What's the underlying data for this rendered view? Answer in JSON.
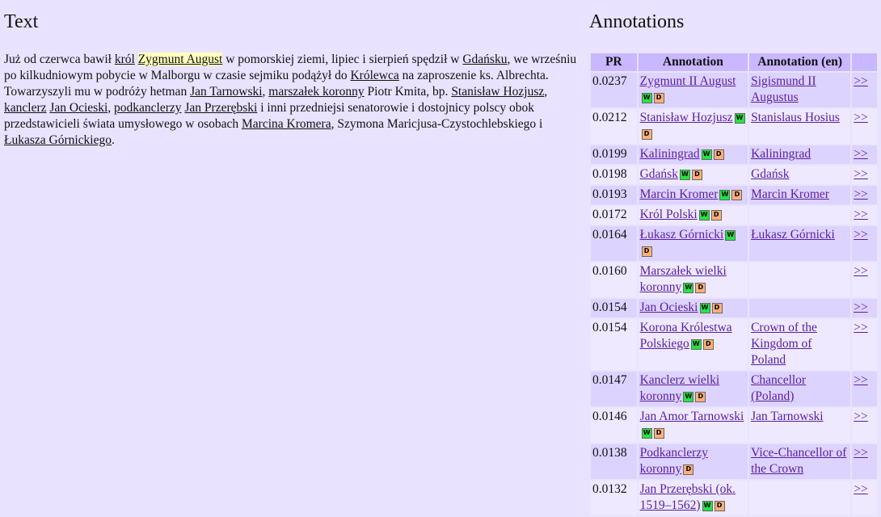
{
  "left": {
    "title": "Text",
    "paragraph": [
      {
        "t": "Już od czerwca bawił "
      },
      {
        "t": "król",
        "link": true
      },
      {
        "t": " "
      },
      {
        "t": "Zygmunt August",
        "link": true,
        "highlight": true
      },
      {
        "t": " w pomorskiej ziemi, lipiec i sierpień spędził w "
      },
      {
        "t": "Gdańsku",
        "link": true
      },
      {
        "t": ", we wrześniu po kilkudniowym pobycie w Malborgu w czasie sejmiku podążył do "
      },
      {
        "t": "Królewca",
        "link": true
      },
      {
        "t": " na zaproszenie ks. Albrechta. Towarzyszyli mu w podróży hetman "
      },
      {
        "t": "Jan Tarnowski",
        "link": true
      },
      {
        "t": ", "
      },
      {
        "t": "marszałek koronny",
        "link": true
      },
      {
        "t": " Piotr Kmita, bp. "
      },
      {
        "t": "Stanisław Hozjusz",
        "link": true
      },
      {
        "t": ", "
      },
      {
        "t": "kanclerz",
        "link": true
      },
      {
        "t": " "
      },
      {
        "t": "Jan Ocieski",
        "link": true
      },
      {
        "t": ", "
      },
      {
        "t": "podkanclerzy",
        "link": true
      },
      {
        "t": " "
      },
      {
        "t": "Jan Przerębski",
        "link": true
      },
      {
        "t": " i inni przedniejsi senatorowie i dostojnicy polscy obok przedstawicieli świata umysłowego w osobach "
      },
      {
        "t": "Marcina Kromera",
        "link": true
      },
      {
        "t": ", Szymona Maricjusa-Czystochlebskiego i "
      },
      {
        "t": "Łukasza Górnickiego",
        "link": true
      },
      {
        "t": "."
      }
    ]
  },
  "right": {
    "title": "Annotations",
    "headers": [
      "PR",
      "Annotation",
      "Annotation (en)",
      ""
    ],
    "badge_w": "W",
    "badge_d": "D",
    "more": ">>",
    "rows": [
      {
        "pr": "0.0237",
        "annotation": "Zygmunt II August",
        "en": "Sigismund II Augustus",
        "w": true,
        "d": true
      },
      {
        "pr": "0.0212",
        "annotation": "Stanisław Hozjusz",
        "en": "Stanislaus Hosius",
        "w": true,
        "d": true
      },
      {
        "pr": "0.0199",
        "annotation": "Kaliningrad",
        "en": "Kaliningrad",
        "w": true,
        "d": true
      },
      {
        "pr": "0.0198",
        "annotation": "Gdańsk",
        "en": "Gdańsk",
        "w": true,
        "d": true
      },
      {
        "pr": "0.0193",
        "annotation": "Marcin Kromer",
        "en": "Marcin Kromer",
        "w": true,
        "d": true
      },
      {
        "pr": "0.0172",
        "annotation": "Król Polski",
        "en": "",
        "w": true,
        "d": true
      },
      {
        "pr": "0.0164",
        "annotation": "Łukasz Górnicki",
        "en": "Łukasz Górnicki",
        "w": true,
        "d": true
      },
      {
        "pr": "0.0160",
        "annotation": "Marszałek wielki koronny",
        "en": "",
        "w": true,
        "d": true
      },
      {
        "pr": "0.0154",
        "annotation": "Jan Ocieski",
        "en": "",
        "w": true,
        "d": true
      },
      {
        "pr": "0.0154",
        "annotation": "Korona Królestwa Polskiego",
        "en": "Crown of the Kingdom of Poland",
        "w": true,
        "d": true
      },
      {
        "pr": "0.0147",
        "annotation": "Kanclerz wielki koronny",
        "en": "Chancellor (Poland)",
        "w": true,
        "d": true
      },
      {
        "pr": "0.0146",
        "annotation": "Jan Amor Tarnowski",
        "en": "Jan Tarnowski",
        "w": true,
        "d": true
      },
      {
        "pr": "0.0138",
        "annotation": "Podkanclerzy koronny",
        "en": "Vice-Chancellor of the Crown",
        "w": false,
        "d": true
      },
      {
        "pr": "0.0132",
        "annotation": "Jan Przerębski (ok. 1519–1562)",
        "en": "",
        "w": true,
        "d": true
      }
    ]
  }
}
